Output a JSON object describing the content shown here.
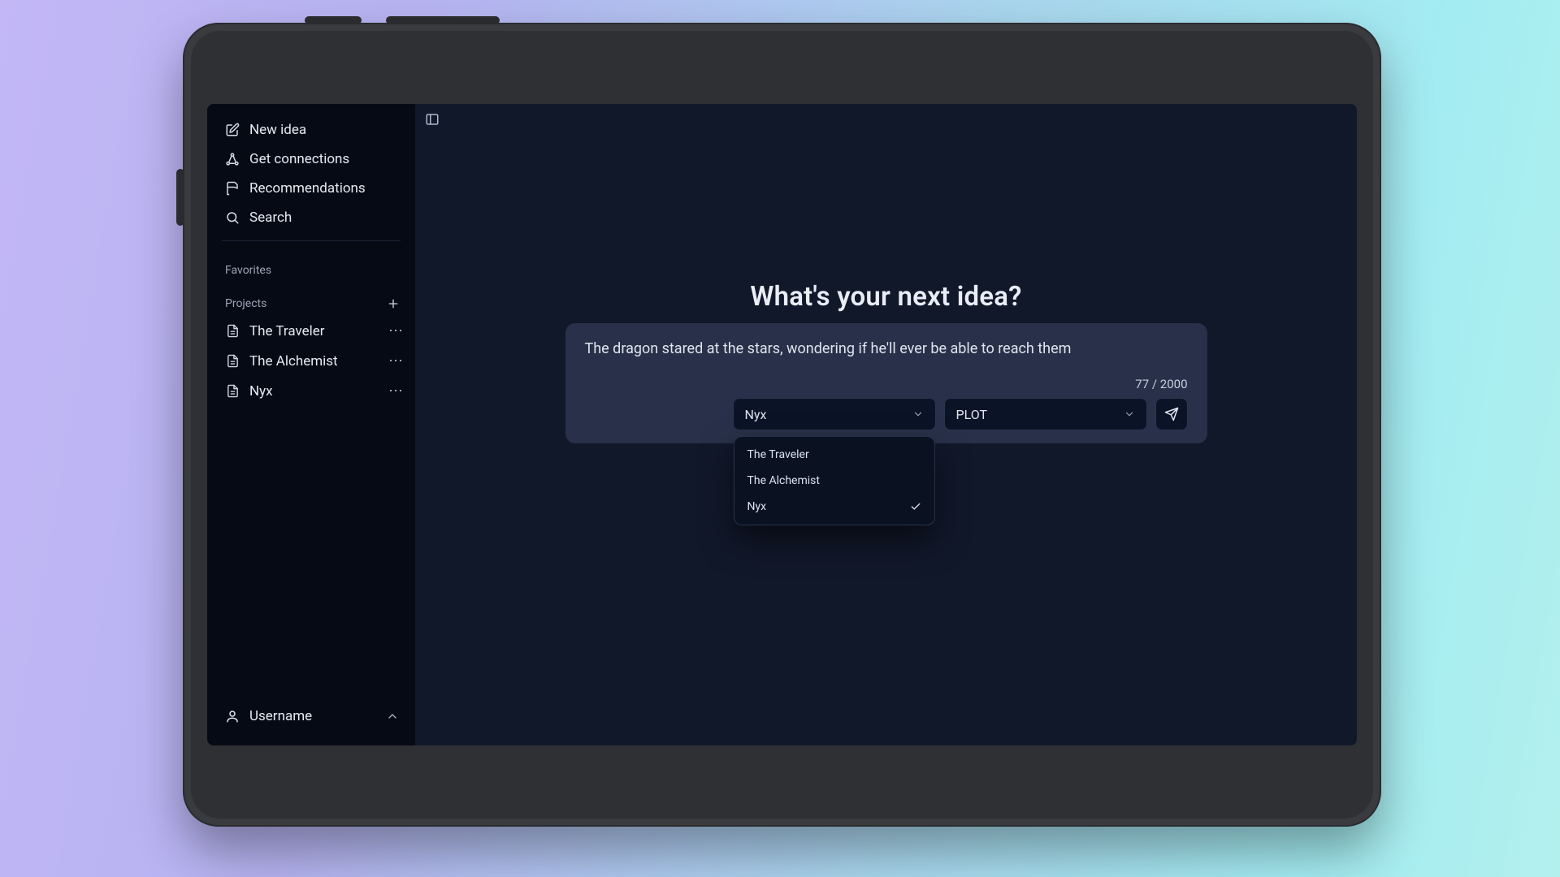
{
  "sidebar": {
    "nav": {
      "new_idea": "New idea",
      "get_connections": "Get connections",
      "recommendations": "Recommendations",
      "search": "Search"
    },
    "favorites_label": "Favorites",
    "projects_label": "Projects",
    "projects": {
      "0": {
        "label": "The Traveler"
      },
      "1": {
        "label": "The Alchemist"
      },
      "2": {
        "label": "Nyx"
      }
    },
    "user": {
      "name": "Username"
    }
  },
  "main": {
    "hero": "What's your next idea?",
    "composer": {
      "text": "The dragon stared at the stars, wondering if he'll ever be able to reach them",
      "counter": "77 / 2000",
      "project_selected": "Nyx",
      "category_selected": "PLOT",
      "dropdown": {
        "0": {
          "label": "The Traveler"
        },
        "1": {
          "label": "The Alchemist"
        },
        "2": {
          "label": "Nyx",
          "selected": true
        }
      }
    }
  }
}
